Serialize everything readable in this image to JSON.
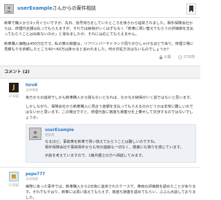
{
  "header": {
    "user": "userExample",
    "title_suffix": "さんからの案件相談"
  },
  "question": {
    "paragraph1": "新車で購入から3ヶ月ぐらいですが、先日、信号待ちをしていたところを後ろから追突されました。相手保険会社からは、修理代全額は払ってもらえますが、それでは納得がいくはずもなく「新車に買い替えてもらうか評価損を支払ってもらうことは出来ないのか」と尋ねましたが、それには応じてもらえません。",
    "paragraph2": "新車購入価格は450万位です。私の車の損害は、リアバンパーやトランク周りがひしゃげるほどであり、修理工場に見積もりを依頼したところ40～60万は掛かると言われました。何か対処方法はないものでしょうか？",
    "public_label": "公開",
    "date_label": "27日前"
  },
  "comments": {
    "heading": "コメント (2)",
    "items": [
      {
        "avatar_letter": "J",
        "name": "hiroK",
        "role": "法律事務",
        "date": "27日前",
        "para1": "後方からの追突でしかも新車購入から間もないとなれば、なかなか納得がいく話ではないと思います。",
        "para2": "しかしながら、保険会社から新車購入に見合う金額を支払ってもらえるのかどうかは非常に難しいのではないかと思います。この場合ですと、修理代金に格落ち損害分を上乗せして交渉するのではないでしょうか。",
        "reply": {
          "name": "userExample",
          "role": "相談者",
          "text1": "なるほど。事故車を新車で買い換えてもらうことは難しいのですね。",
          "text2": "相手保険会社や事故相手からも何の連絡も一切なく、態度にも憤りを感じています。",
          "text3": "示談を考えていますので、1度弁護士の方へ相談してみます。"
        }
      },
      {
        "avatar_letter": "",
        "name": "pepe777",
        "role": "法律事務",
        "date": "27日前",
        "para1": "実際にあった事件では、新車購入から2日後に追突されたケースで、車両の評価損を認めたことがあります。それでもやはり、新車には買い換えてもらえず、格落ち損害を認めてもらい、ぶぶん示談しておりました。"
      }
    ]
  }
}
